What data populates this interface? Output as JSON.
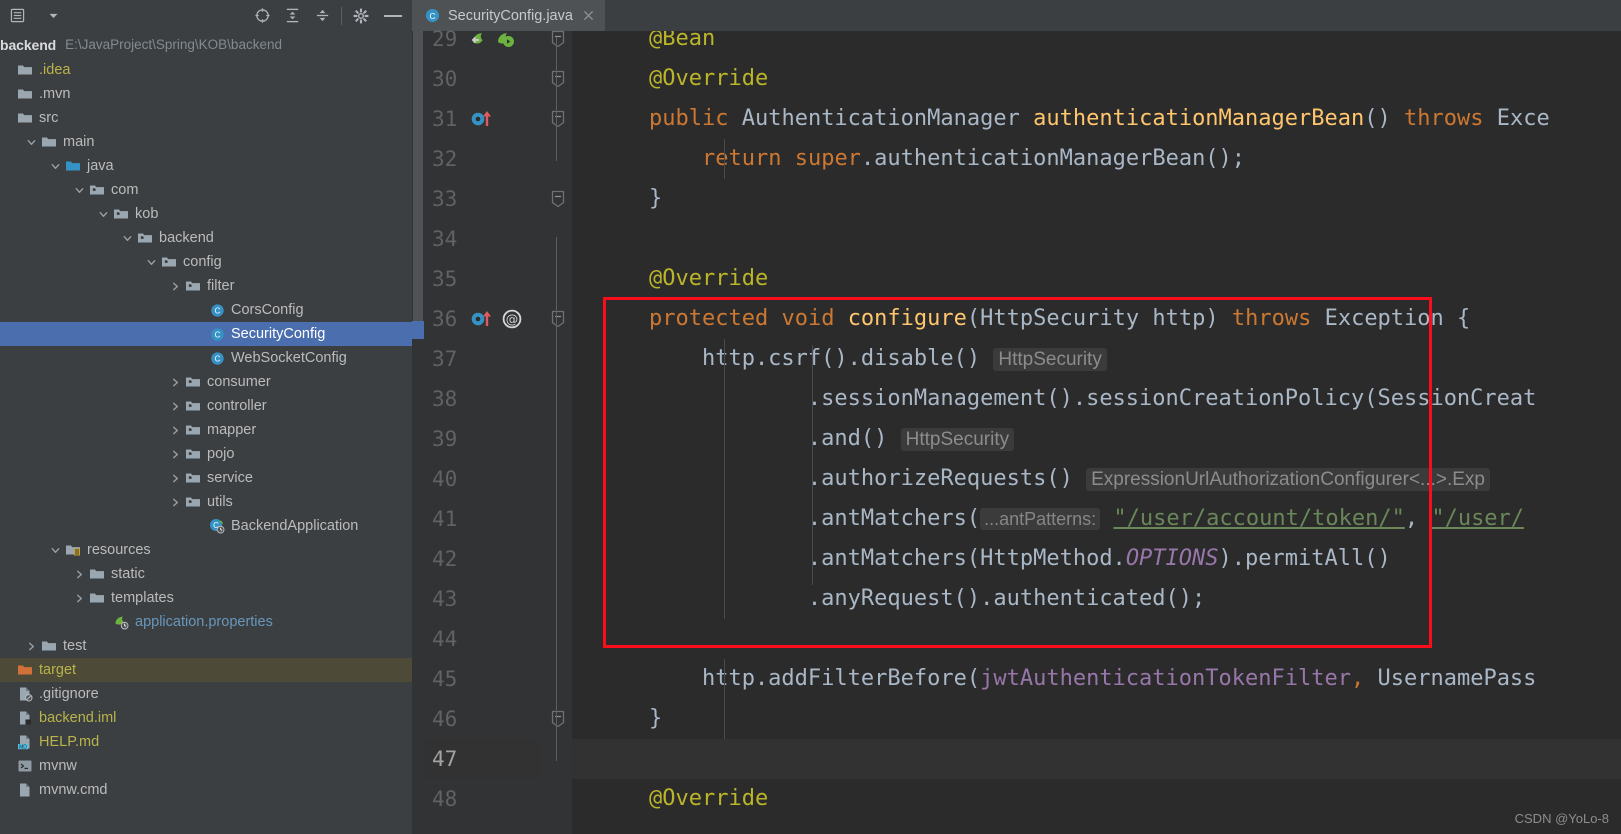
{
  "window": {
    "sidebar_toolbar": {
      "menu_icon": "hamburger-icon",
      "dropdown_icon": "chevron-down-icon",
      "locate_icon": "crosshair-target-icon",
      "expand_all_icon": "expand-all-icon",
      "collapse_all_icon": "collapse-all-icon",
      "settings_icon": "gear-icon",
      "hide_icon": "minimize-icon"
    },
    "project": {
      "name": "backend",
      "path": "E:\\JavaProject\\Spring\\KOB\\backend"
    }
  },
  "tree": [
    {
      "label": ".idea",
      "indent": 0,
      "arrow": "none",
      "icon": "folder",
      "color": "yellow",
      "state": "normal"
    },
    {
      "label": ".mvn",
      "indent": 0,
      "arrow": "none",
      "icon": "folder",
      "color": "plain",
      "state": "normal"
    },
    {
      "label": "src",
      "indent": 0,
      "arrow": "none",
      "icon": "folder",
      "color": "plain",
      "state": "normal"
    },
    {
      "label": "main",
      "indent": 1,
      "arrow": "expanded",
      "icon": "folder",
      "color": "plain",
      "state": "normal"
    },
    {
      "label": "java",
      "indent": 2,
      "arrow": "expanded",
      "icon": "source-folder",
      "color": "plain",
      "state": "normal"
    },
    {
      "label": "com",
      "indent": 3,
      "arrow": "expanded",
      "icon": "package",
      "color": "plain",
      "state": "normal"
    },
    {
      "label": "kob",
      "indent": 4,
      "arrow": "expanded",
      "icon": "package",
      "color": "plain",
      "state": "normal"
    },
    {
      "label": "backend",
      "indent": 5,
      "arrow": "expanded",
      "icon": "package",
      "color": "plain",
      "state": "normal"
    },
    {
      "label": "config",
      "indent": 6,
      "arrow": "expanded",
      "icon": "package",
      "color": "plain",
      "state": "normal"
    },
    {
      "label": "filter",
      "indent": 7,
      "arrow": "collapsed",
      "icon": "package",
      "color": "plain",
      "state": "normal"
    },
    {
      "label": "CorsConfig",
      "indent": 8,
      "arrow": "none",
      "icon": "java-class",
      "color": "plain",
      "state": "normal"
    },
    {
      "label": "SecurityConfig",
      "indent": 8,
      "arrow": "none",
      "icon": "java-class",
      "color": "plain",
      "state": "selected"
    },
    {
      "label": "WebSocketConfig",
      "indent": 8,
      "arrow": "none",
      "icon": "java-class",
      "color": "plain",
      "state": "normal"
    },
    {
      "label": "consumer",
      "indent": 7,
      "arrow": "collapsed",
      "icon": "package",
      "color": "plain",
      "state": "normal"
    },
    {
      "label": "controller",
      "indent": 7,
      "arrow": "collapsed",
      "icon": "package",
      "color": "plain",
      "state": "normal"
    },
    {
      "label": "mapper",
      "indent": 7,
      "arrow": "collapsed",
      "icon": "package",
      "color": "plain",
      "state": "normal"
    },
    {
      "label": "pojo",
      "indent": 7,
      "arrow": "collapsed",
      "icon": "package",
      "color": "plain",
      "state": "normal"
    },
    {
      "label": "service",
      "indent": 7,
      "arrow": "collapsed",
      "icon": "package",
      "color": "plain",
      "state": "normal"
    },
    {
      "label": "utils",
      "indent": 7,
      "arrow": "collapsed",
      "icon": "package",
      "color": "plain",
      "state": "normal"
    },
    {
      "label": "BackendApplication",
      "indent": 8,
      "arrow": "none",
      "icon": "spring-class",
      "color": "plain",
      "state": "normal"
    },
    {
      "label": "resources",
      "indent": 2,
      "arrow": "expanded",
      "icon": "resource-folder",
      "color": "plain",
      "state": "normal"
    },
    {
      "label": "static",
      "indent": 3,
      "arrow": "collapsed",
      "icon": "folder",
      "color": "plain",
      "state": "normal"
    },
    {
      "label": "templates",
      "indent": 3,
      "arrow": "collapsed",
      "icon": "folder",
      "color": "plain",
      "state": "normal"
    },
    {
      "label": "application.properties",
      "indent": 4,
      "arrow": "none",
      "icon": "spring-props",
      "color": "blue",
      "state": "normal"
    },
    {
      "label": "test",
      "indent": 1,
      "arrow": "collapsed",
      "icon": "folder",
      "color": "plain",
      "state": "normal"
    },
    {
      "label": "target",
      "indent": 0,
      "arrow": "none",
      "icon": "excluded-folder",
      "color": "yellow",
      "state": "context"
    },
    {
      "label": ".gitignore",
      "indent": 0,
      "arrow": "none",
      "icon": "gitignore-file",
      "color": "plain",
      "state": "normal"
    },
    {
      "label": "backend.iml",
      "indent": 0,
      "arrow": "none",
      "icon": "iml-file",
      "color": "yellow",
      "state": "normal"
    },
    {
      "label": "HELP.md",
      "indent": 0,
      "arrow": "none",
      "icon": "md-file",
      "color": "yellow",
      "state": "normal"
    },
    {
      "label": "mvnw",
      "indent": 0,
      "arrow": "none",
      "icon": "script-file",
      "color": "plain",
      "state": "normal"
    },
    {
      "label": "mvnw.cmd",
      "indent": 0,
      "arrow": "none",
      "icon": "cmd-file",
      "color": "plain",
      "state": "normal"
    }
  ],
  "editor": {
    "tab": {
      "label": "SecurityConfig.java",
      "icon": "java-class-icon",
      "close_icon": "close-icon"
    },
    "first_line": 29,
    "caret_line": 47,
    "lines": [
      {
        "n": 29,
        "gutter": [
          "bean-icon",
          "bean-run-icon"
        ],
        "fold": "end"
      },
      {
        "n": 30,
        "gutter": [],
        "fold": "collapse"
      },
      {
        "n": 31,
        "gutter": [
          "override-method-icon"
        ],
        "fold": "end"
      },
      {
        "n": 32,
        "gutter": [],
        "fold": "none"
      },
      {
        "n": 33,
        "gutter": [],
        "fold": "collapse"
      },
      {
        "n": 34,
        "gutter": [],
        "fold": "none"
      },
      {
        "n": 35,
        "gutter": [],
        "fold": "none"
      },
      {
        "n": 36,
        "gutter": [
          "override-method-icon",
          "annotation-icon"
        ],
        "fold": "end"
      },
      {
        "n": 37,
        "gutter": [],
        "fold": "none"
      },
      {
        "n": 38,
        "gutter": [],
        "fold": "none"
      },
      {
        "n": 39,
        "gutter": [],
        "fold": "none"
      },
      {
        "n": 40,
        "gutter": [],
        "fold": "none"
      },
      {
        "n": 41,
        "gutter": [],
        "fold": "none"
      },
      {
        "n": 42,
        "gutter": [],
        "fold": "none"
      },
      {
        "n": 43,
        "gutter": [],
        "fold": "none"
      },
      {
        "n": 44,
        "gutter": [],
        "fold": "none"
      },
      {
        "n": 45,
        "gutter": [],
        "fold": "none"
      },
      {
        "n": 46,
        "gutter": [],
        "fold": "collapse"
      },
      {
        "n": 47,
        "gutter": [],
        "fold": "none"
      },
      {
        "n": 48,
        "gutter": [],
        "fold": "none"
      }
    ],
    "code": {
      "l29": {
        "indent": "    ",
        "ann": "@Bean"
      },
      "l30": {
        "indent": "    ",
        "ann": "@Override"
      },
      "l31": {
        "indent": "    ",
        "kw1": "public",
        "type": "AuthenticationManager",
        "method": "authenticationManagerBean",
        "parens": "()",
        "kw2": "throws",
        "exc": "Exce"
      },
      "l32": {
        "text": "        return super.authenticationManagerBean();",
        "kw_return": "return",
        "kw_super": "super",
        "rest": ".authenticationManagerBean();"
      },
      "l33": {
        "text": "    }"
      },
      "l35": {
        "indent": "    ",
        "ann": "@Override"
      },
      "l36": {
        "kw1": "protected",
        "kw2": "void",
        "method": "configure",
        "open": "(",
        "type": "HttpSecurity",
        "param": " http",
        "close": ")",
        "kw3": "throws",
        "exc": "Exception",
        "brace": " {"
      },
      "l37": {
        "text": "        http.csrf().disable()",
        "hint": "HttpSecurity"
      },
      "l38": {
        "text": "                .sessionManagement().sessionCreationPolicy(SessionCreat"
      },
      "l39": {
        "text": "                .and()",
        "hint": "HttpSecurity"
      },
      "l40": {
        "text": "                .authorizeRequests()",
        "hint": "ExpressionUrlAuthorizationConfigurer<...>.Exp"
      },
      "l41": {
        "pre": "                .antMatchers(",
        "phint": "...antPatterns:",
        "s1": "\"/user/account/token/\"",
        "comma": ", ",
        "s2": "\"/user/"
      },
      "l42": {
        "pre": "                .antMatchers(HttpMethod.",
        "sf": "OPTIONS",
        "post": ").permitAll()"
      },
      "l43": {
        "text": "                .anyRequest().authenticated();"
      },
      "l45": {
        "pre": "        http.addFilterBefore(",
        "field": "jwtAuthenticationTokenFilter",
        "comma": ", ",
        "post": "UsernamePass"
      },
      "l46": {
        "text": "    }"
      },
      "l48": {
        "indent": "    ",
        "ann": "@Override"
      }
    },
    "annotation_box": {
      "label": "red-highlight-box",
      "color": "#fc0d1b"
    }
  },
  "watermark": "CSDN @YoLo-8"
}
